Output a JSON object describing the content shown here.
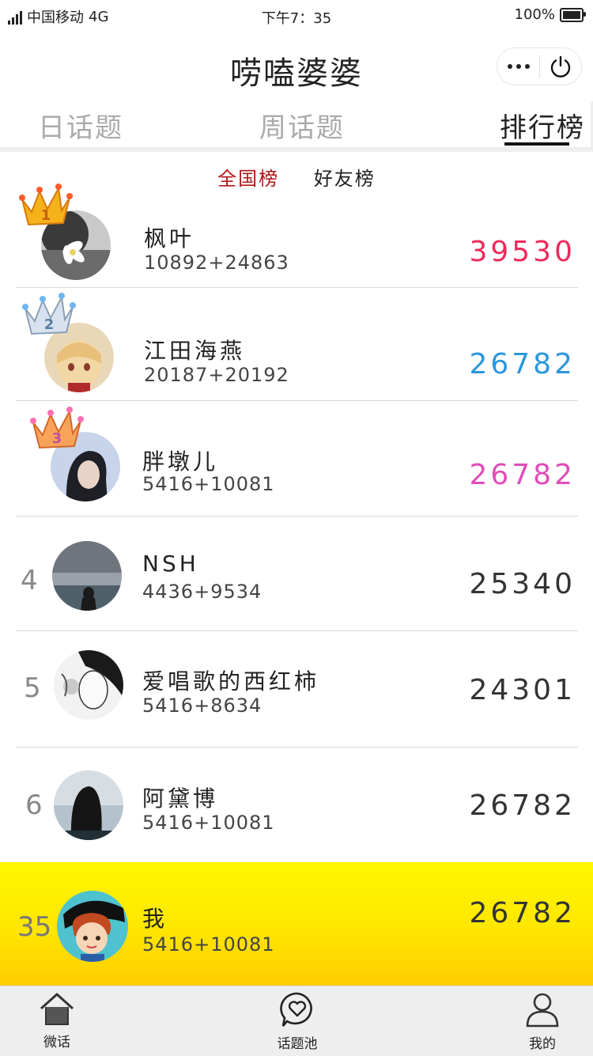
{
  "status_bar": {
    "carrier": "中国移动",
    "network": "4G",
    "time": "下午7：35",
    "battery": "100%"
  },
  "nav": {
    "title": "唠嗑婆婆"
  },
  "tabs": [
    {
      "label": "日话题",
      "active": false
    },
    {
      "label": "周话题",
      "active": false
    },
    {
      "label": "排行榜",
      "active": true
    }
  ],
  "subtabs": {
    "national": "全国榜",
    "friends": "好友榜"
  },
  "ranking": [
    {
      "rank": "1",
      "name": "枫叶",
      "breakdown": "10892+24863",
      "score": "39530",
      "score_color": "#ee2a5a"
    },
    {
      "rank": "2",
      "name": "江田海燕",
      "breakdown": "20187+20192",
      "score": "26782",
      "score_color": "#2b96dd"
    },
    {
      "rank": "3",
      "name": "胖墩儿",
      "breakdown": "5416+10081",
      "score": "26782",
      "score_color": "#e04db9"
    },
    {
      "rank": "4",
      "name": "NSH",
      "breakdown": "4436+9534",
      "score": "25340",
      "score_color": "#333333"
    },
    {
      "rank": "5",
      "name": "爱唱歌的西红柿",
      "breakdown": "5416+8634",
      "score": "24301",
      "score_color": "#333333"
    },
    {
      "rank": "6",
      "name": "阿黛博",
      "breakdown": "5416+10081",
      "score": "26782",
      "score_color": "#333333"
    }
  ],
  "me": {
    "rank": "35",
    "name": "我",
    "breakdown": "5416+10081",
    "score": "26782"
  },
  "tabbar": [
    {
      "label": "微话",
      "icon": "home-icon"
    },
    {
      "label": "话题池",
      "icon": "heart-chat-icon"
    },
    {
      "label": "我的",
      "icon": "person-icon"
    }
  ]
}
